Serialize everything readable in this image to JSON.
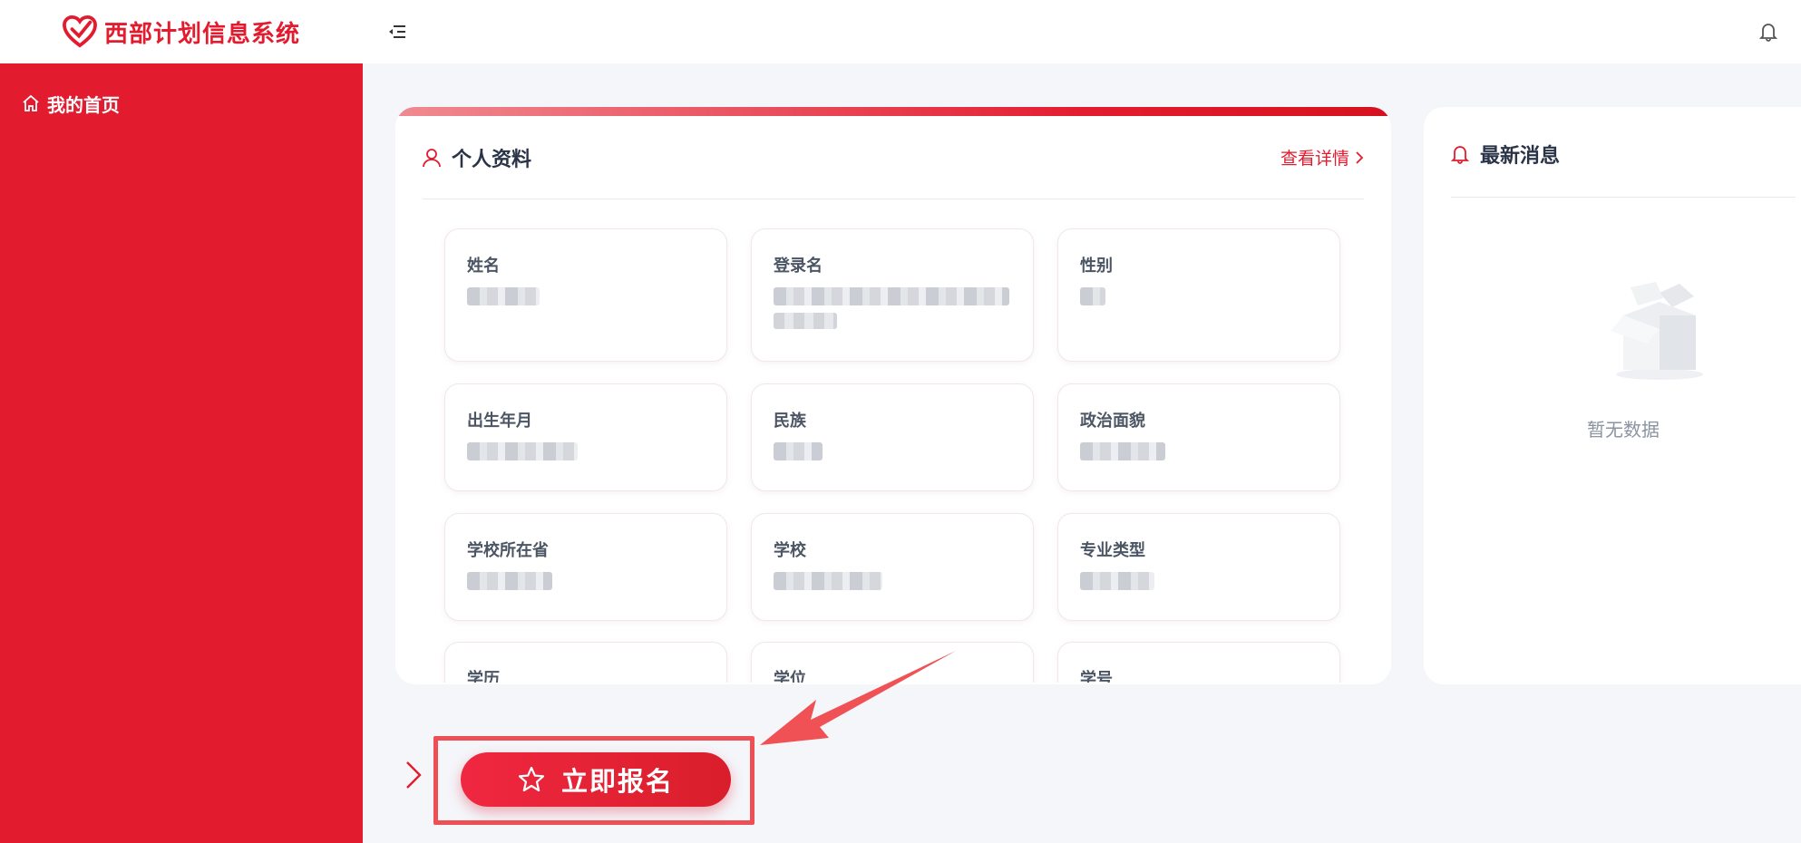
{
  "app": {
    "title": "西部计划信息系统",
    "brand_color": "#e31b2e"
  },
  "sidebar": {
    "items": [
      {
        "label": "我的首页",
        "icon": "home-icon"
      }
    ]
  },
  "topbar": {
    "menu_icon": "menu-fold-icon",
    "bell_icon": "bell-icon"
  },
  "profile": {
    "title": "个人资料",
    "detail_link": "查看详情",
    "fields": [
      {
        "label": "姓名"
      },
      {
        "label": "登录名"
      },
      {
        "label": "性别"
      },
      {
        "label": "出生年月"
      },
      {
        "label": "民族"
      },
      {
        "label": "政治面貌"
      },
      {
        "label": "学校所在省"
      },
      {
        "label": "学校"
      },
      {
        "label": "专业类型"
      },
      {
        "label": "学历"
      },
      {
        "label": "学位"
      },
      {
        "label": "学号"
      }
    ]
  },
  "news": {
    "title": "最新消息",
    "empty_text": "暂无数据"
  },
  "signup": {
    "label": "立即报名"
  }
}
